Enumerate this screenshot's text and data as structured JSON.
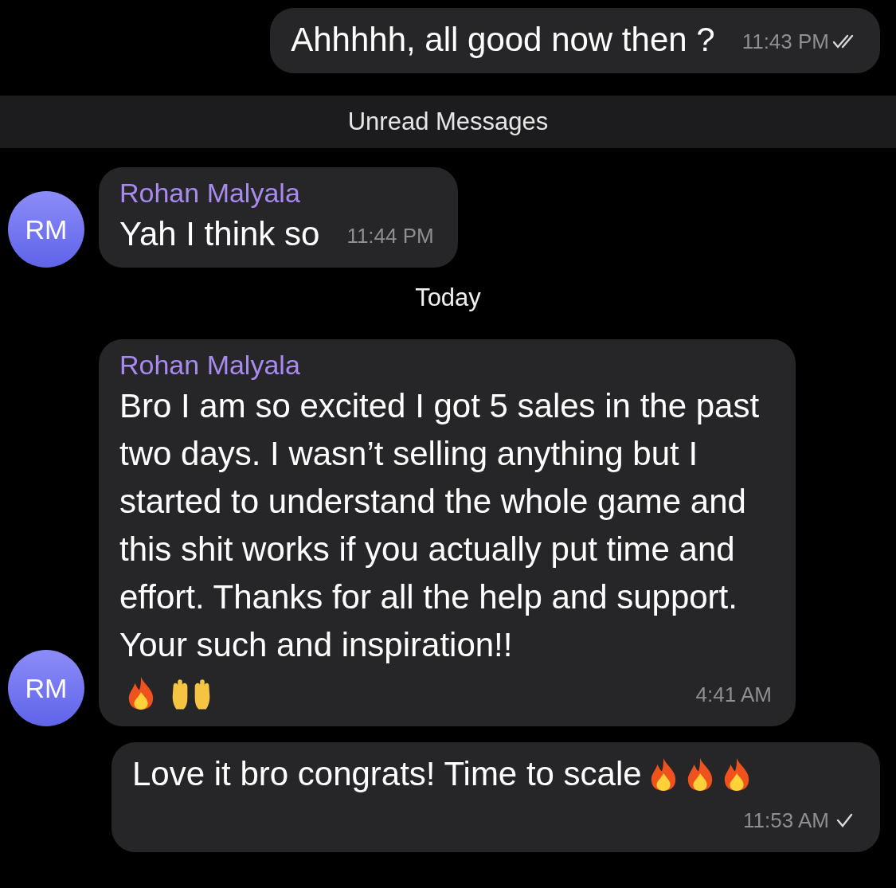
{
  "messages": [
    {
      "kind": "outgoing",
      "text": "Ahhhhh, all good now then ?",
      "time": "11:43 PM",
      "read": true
    },
    {
      "kind": "divider",
      "text": "Unread Messages"
    },
    {
      "kind": "incoming",
      "sender": "Rohan Malyala",
      "avatar": "RM",
      "text": "Yah I think so",
      "time": "11:44 PM"
    },
    {
      "kind": "date",
      "text": "Today"
    },
    {
      "kind": "incoming",
      "sender": "Rohan Malyala",
      "avatar": "RM",
      "text": "Bro I am so excited I got 5 sales in the past two days. I wasn’t selling anything but I started to understand the whole game and this shit works if you actually put time and effort. Thanks for all the help and support. Your such and inspiration!!",
      "time": "4:41 AM",
      "emojis": [
        {
          "kind": "fire"
        },
        {
          "kind": "raised-hands"
        }
      ]
    },
    {
      "kind": "outgoing",
      "text": "Love it bro congrats! Time to scale",
      "time": "11:53 AM",
      "read": false,
      "emojis": [
        {
          "kind": "fire"
        },
        {
          "kind": "fire"
        },
        {
          "kind": "fire"
        }
      ]
    }
  ]
}
